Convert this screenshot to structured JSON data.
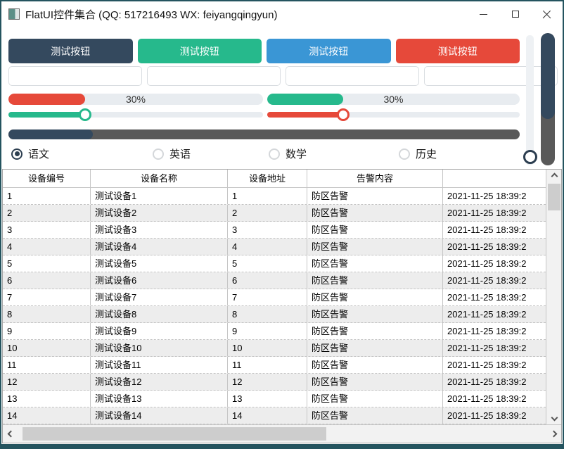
{
  "window": {
    "title": "FlatUI控件集合 (QQ: 517216493 WX: feiyangqingyun)"
  },
  "colors": {
    "navy": "#34495e",
    "green": "#26b98c",
    "blue": "#3a96d5",
    "red": "#e6493a",
    "dark_track": "#595959",
    "window_border": "#24545f"
  },
  "toolbar": {
    "buttons": [
      {
        "label": "测试按钮",
        "color": "#34495e"
      },
      {
        "label": "测试按钮",
        "color": "#26b98c"
      },
      {
        "label": "测试按钮",
        "color": "#3a96d5"
      },
      {
        "label": "测试按钮",
        "color": "#e6493a"
      }
    ]
  },
  "inputs": [
    {
      "value": "",
      "placeholder": ""
    },
    {
      "value": "",
      "placeholder": ""
    },
    {
      "value": "",
      "placeholder": ""
    },
    {
      "value": "",
      "placeholder": ""
    }
  ],
  "progress_bars": {
    "left": {
      "percent": 30,
      "label": "30%",
      "color": "#e6493a"
    },
    "right": {
      "percent": 30,
      "label": "30%",
      "color": "#26b98c"
    }
  },
  "sliders": {
    "left": {
      "percent": 30,
      "color": "#26b98c"
    },
    "right": {
      "percent": 30,
      "color": "#e6493a"
    }
  },
  "dark_bar": {
    "percent": 16.5
  },
  "vertical_progress": {
    "percent": 65
  },
  "radios": {
    "items": [
      {
        "label": "语文",
        "selected": true
      },
      {
        "label": "英语",
        "selected": false
      },
      {
        "label": "数学",
        "selected": false
      },
      {
        "label": "历史",
        "selected": false
      }
    ]
  },
  "table": {
    "columns": [
      "设备编号",
      "设备名称",
      "设备地址",
      "告警内容",
      ""
    ],
    "rows": [
      [
        "1",
        "测试设备1",
        "1",
        "防区告警",
        "2021-11-25 18:39:2"
      ],
      [
        "2",
        "测试设备2",
        "2",
        "防区告警",
        "2021-11-25 18:39:2"
      ],
      [
        "3",
        "测试设备3",
        "3",
        "防区告警",
        "2021-11-25 18:39:2"
      ],
      [
        "4",
        "测试设备4",
        "4",
        "防区告警",
        "2021-11-25 18:39:2"
      ],
      [
        "5",
        "测试设备5",
        "5",
        "防区告警",
        "2021-11-25 18:39:2"
      ],
      [
        "6",
        "测试设备6",
        "6",
        "防区告警",
        "2021-11-25 18:39:2"
      ],
      [
        "7",
        "测试设备7",
        "7",
        "防区告警",
        "2021-11-25 18:39:2"
      ],
      [
        "8",
        "测试设备8",
        "8",
        "防区告警",
        "2021-11-25 18:39:2"
      ],
      [
        "9",
        "测试设备9",
        "9",
        "防区告警",
        "2021-11-25 18:39:2"
      ],
      [
        "10",
        "测试设备10",
        "10",
        "防区告警",
        "2021-11-25 18:39:2"
      ],
      [
        "11",
        "测试设备11",
        "11",
        "防区告警",
        "2021-11-25 18:39:2"
      ],
      [
        "12",
        "测试设备12",
        "12",
        "防区告警",
        "2021-11-25 18:39:2"
      ],
      [
        "13",
        "测试设备13",
        "13",
        "防区告警",
        "2021-11-25 18:39:2"
      ],
      [
        "14",
        "测试设备14",
        "14",
        "防区告警",
        "2021-11-25 18:39:2"
      ]
    ]
  }
}
